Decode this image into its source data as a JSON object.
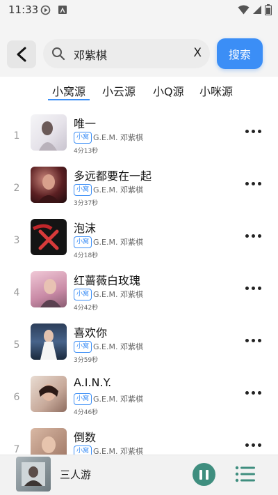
{
  "status_bar": {
    "time": "11:33"
  },
  "search": {
    "query": "邓紫棋",
    "clear_label": "X",
    "button_label": "搜索"
  },
  "tabs": [
    "小窝源",
    "小云源",
    "小Q源",
    "小咪源"
  ],
  "songs": [
    {
      "index": "1",
      "title": "唯一",
      "badge": "小窝",
      "artist": "G.E.M. 邓紫棋",
      "duration": "4分13秒"
    },
    {
      "index": "2",
      "title": "多远都要在一起",
      "badge": "小窝",
      "artist": "G.E.M. 邓紫棋",
      "duration": "3分37秒"
    },
    {
      "index": "3",
      "title": "泡沫",
      "badge": "小窝",
      "artist": "G.E.M. 邓紫棋",
      "duration": "4分18秒"
    },
    {
      "index": "4",
      "title": "红蔷薇白玫瑰",
      "badge": "小窝",
      "artist": "G.E.M. 邓紫棋",
      "duration": "4分42秒"
    },
    {
      "index": "5",
      "title": "喜欢你",
      "badge": "小窝",
      "artist": "G.E.M. 邓紫棋",
      "duration": "3分59秒"
    },
    {
      "index": "6",
      "title": "A.I.N.Y.",
      "badge": "小窝",
      "artist": "G.E.M. 邓紫棋",
      "duration": "4分46秒"
    },
    {
      "index": "7",
      "title": "倒数",
      "badge": "小窝",
      "artist": "G.E.M. 邓紫棋",
      "duration": ""
    }
  ],
  "player": {
    "title": "三人游"
  },
  "colors": {
    "accent": "#3b8ef6",
    "player_button": "#3f8e7f",
    "background": "#f4f4f4"
  }
}
